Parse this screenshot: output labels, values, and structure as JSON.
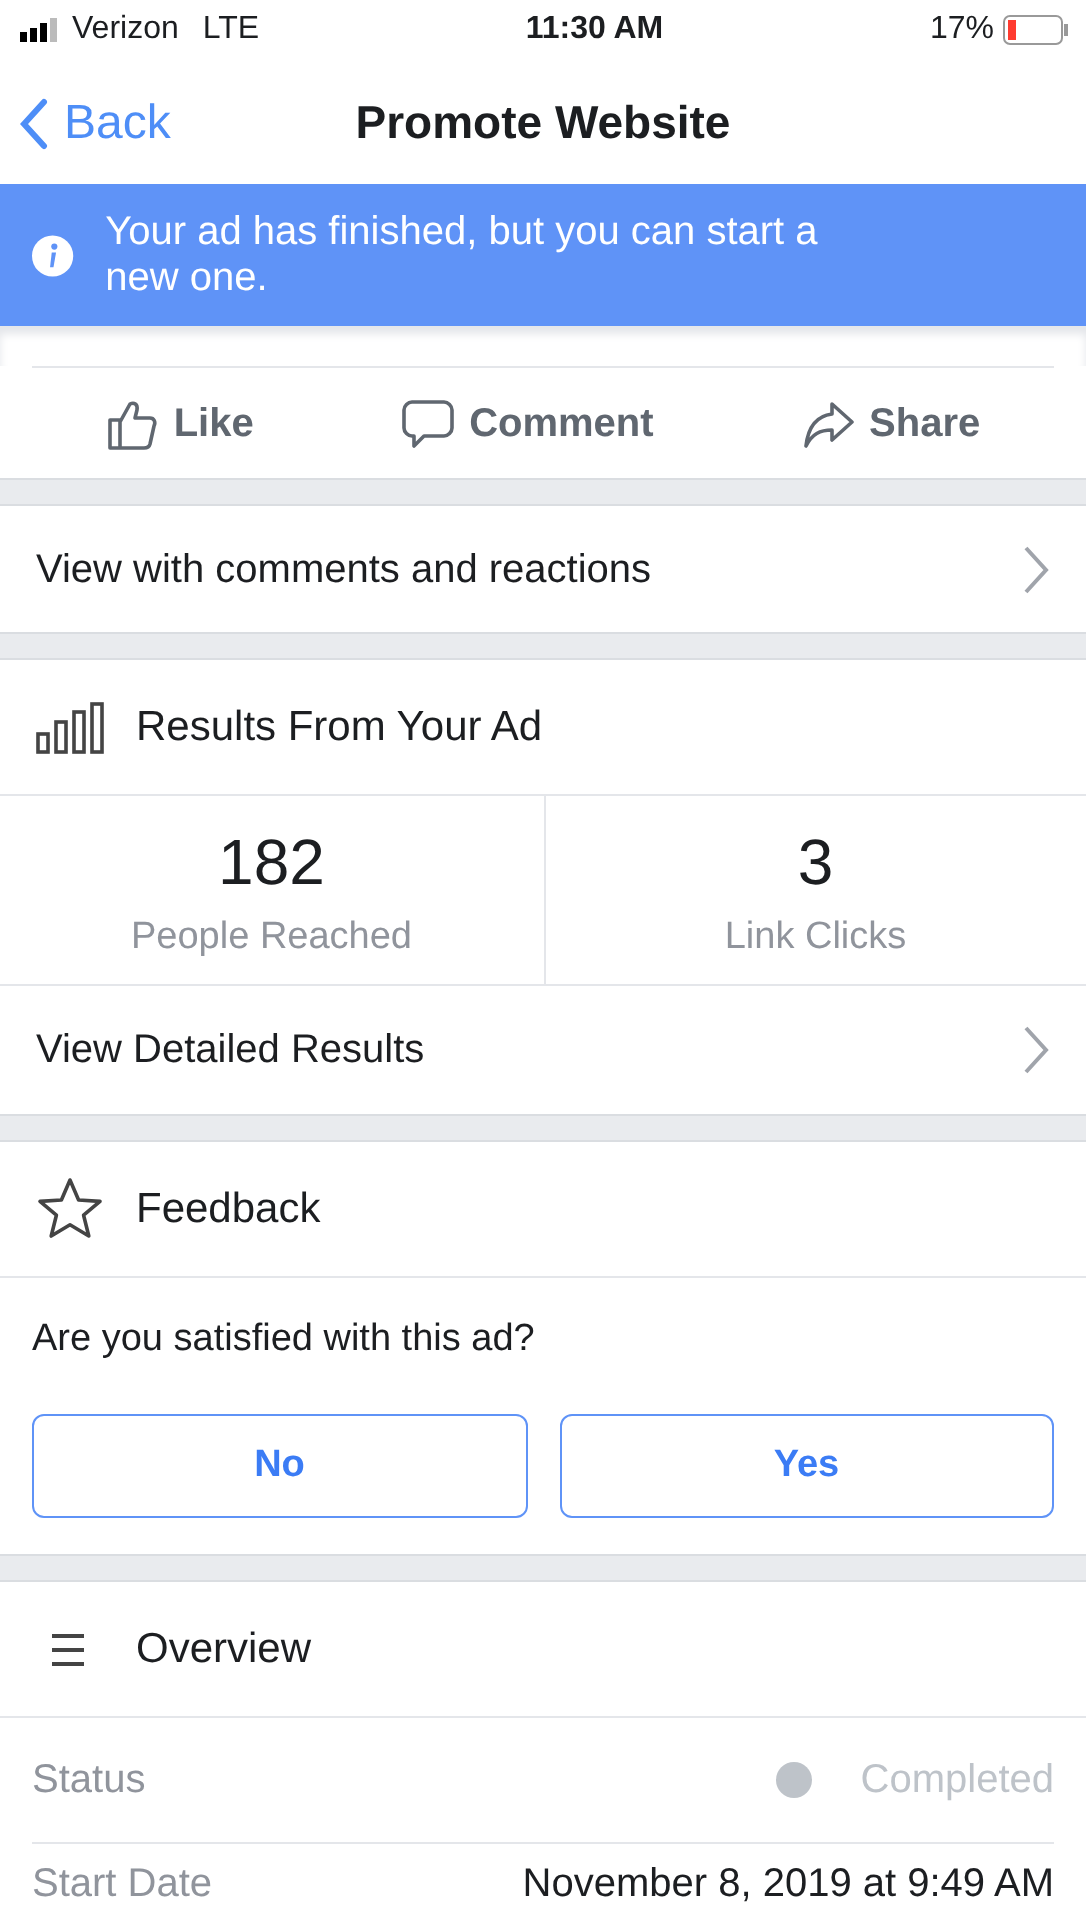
{
  "status_bar": {
    "carrier": "Verizon",
    "network": "LTE",
    "time": "11:30 AM",
    "battery": "17%"
  },
  "nav": {
    "back": "Back",
    "title": "Promote Website"
  },
  "banner": {
    "text": "Your ad has finished, but you can start a new one."
  },
  "actions": [
    {
      "kind": "like",
      "label": "Like"
    },
    {
      "kind": "comment",
      "label": "Comment"
    },
    {
      "kind": "share",
      "label": "Share"
    }
  ],
  "view_comments": "View with comments and reactions",
  "results": {
    "title": "Results From Your Ad",
    "stats": [
      {
        "value": "182",
        "label": "People Reached"
      },
      {
        "value": "3",
        "label": "Link Clicks"
      }
    ],
    "detail_link": "View Detailed Results"
  },
  "feedback": {
    "title": "Feedback",
    "question": "Are you satisfied with this ad?",
    "buttons": [
      "No",
      "Yes"
    ]
  },
  "overview": {
    "title": "Overview",
    "rows": [
      {
        "label": "Status",
        "value": "Completed",
        "kind": "status"
      },
      {
        "label": "Start Date",
        "value": "November 8, 2019 at 9:49 AM",
        "kind": "text"
      }
    ]
  }
}
